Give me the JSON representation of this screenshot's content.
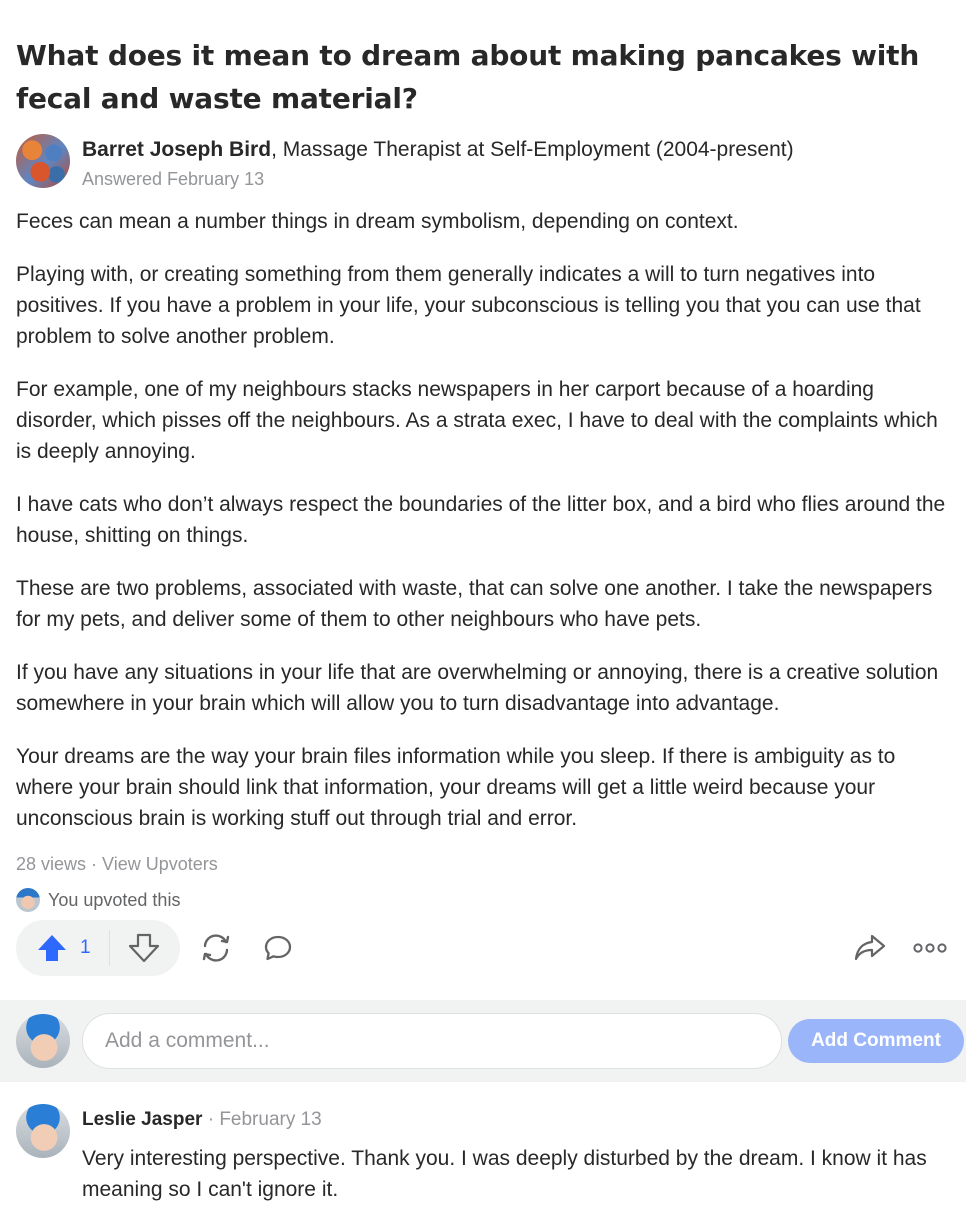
{
  "question": {
    "title": "What does it mean to dream about making pancakes with fecal and waste material?"
  },
  "answer": {
    "author_name": "Barret Joseph Bird",
    "author_credential": ", Massage Therapist at Self-Employment (2004-present)",
    "answered_date": "Answered February 13",
    "paragraphs": [
      "Feces can mean a number things in dream symbolism, depending on context.",
      "Playing with, or creating something from them generally indicates a will to turn negatives into positives. If you have a problem in your life, your subconscious is telling you that you can use that problem to solve another problem.",
      "For example, one of my neighbours stacks newspapers in her carport because of a hoarding disorder, which pisses off the neighbours. As a strata exec, I have to deal with the complaints which is deeply annoying.",
      "I have cats who don’t always respect the boundaries of the litter box, and a bird who flies around the house, shitting on things.",
      "These are two problems, associated with waste, that can solve one another. I take the newspapers for my pets, and deliver some of them to other neighbours who have pets.",
      "If you have any situations in your life that are overwhelming or annoying, there is a creative solution somewhere in your brain which will allow you to turn disadvantage into advantage.",
      "Your dreams are the way your brain files information while you sleep. If there is ambiguity as to where your brain should link that information, your dreams will get a little weird because your unconscious brain is working stuff out through trial and error."
    ],
    "views": "28 views",
    "separator": " · ",
    "view_upvoters": "View Upvoters",
    "upvoted_text": "You upvoted this",
    "upvote_count": "1"
  },
  "icons": {
    "upvote": "arrow-up-icon",
    "downvote": "arrow-down-icon",
    "share": "reshare-icon",
    "comment": "comment-bubble-icon",
    "forward": "share-arrow-icon",
    "more": "more-dots-icon"
  },
  "colors": {
    "accent": "#2e69ff",
    "button_disabled": "#9bb5fb",
    "muted": "#939598",
    "bar_bg": "#f1f2f2"
  },
  "comment_box": {
    "placeholder": "Add a comment...",
    "button_label": "Add Comment"
  },
  "comments": [
    {
      "author": "Leslie Jasper",
      "separator": " · ",
      "date": "February 13",
      "text": "Very interesting perspective. Thank you. I was deeply disturbed by the dream. I know it has meaning so I can't ignore it."
    }
  ]
}
